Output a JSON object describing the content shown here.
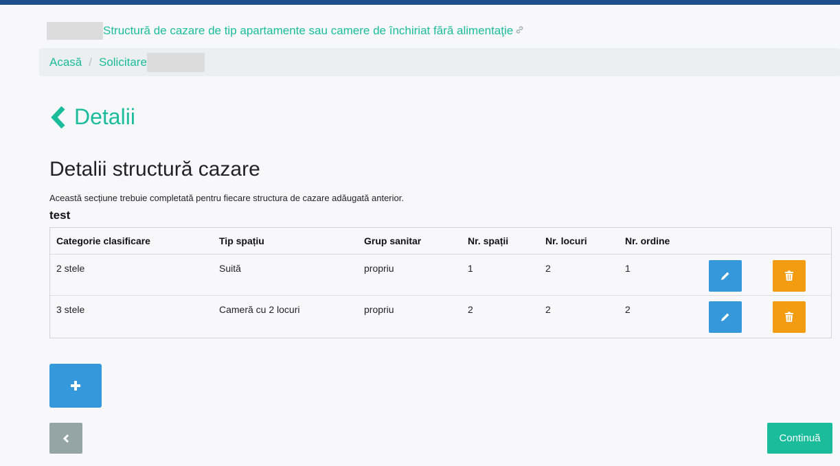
{
  "header": {
    "title": "Structură de cazare de tip apartamente sau camere de închiriat fără alimentaţie",
    "link_icon": "link-icon"
  },
  "breadcrumb": {
    "items": [
      "Acasă",
      "Solicitare"
    ],
    "separator": "/"
  },
  "back_heading": {
    "label": "Detalii",
    "icon": "chevron-left-icon"
  },
  "section": {
    "title": "Detalii structură cazare",
    "description": "Această secțiune trebuie completată pentru fiecare structura de cazare adăugată anterior.",
    "structure_name": "test"
  },
  "table": {
    "headers": [
      "Categorie clasificare",
      "Tip spațiu",
      "Grup sanitar",
      "Nr. spații",
      "Nr. locuri",
      "Nr. ordine"
    ],
    "rows": [
      [
        "2 stele",
        "Suită",
        "propriu",
        "1",
        "2",
        "1"
      ],
      [
        "3 stele",
        "Cameră cu 2 locuri",
        "propriu",
        "2",
        "2",
        "2"
      ]
    ]
  },
  "buttons": {
    "continue": "Continuă",
    "add_icon": "plus-icon",
    "back_icon": "chevron-left-icon",
    "edit_icon": "pencil-icon",
    "delete_icon": "trash-icon"
  },
  "colors": {
    "accent": "#1abc9c",
    "primary": "#3498db",
    "warning": "#f39c12",
    "muted": "#95a5a6",
    "topbar": "#1f4e8c"
  }
}
